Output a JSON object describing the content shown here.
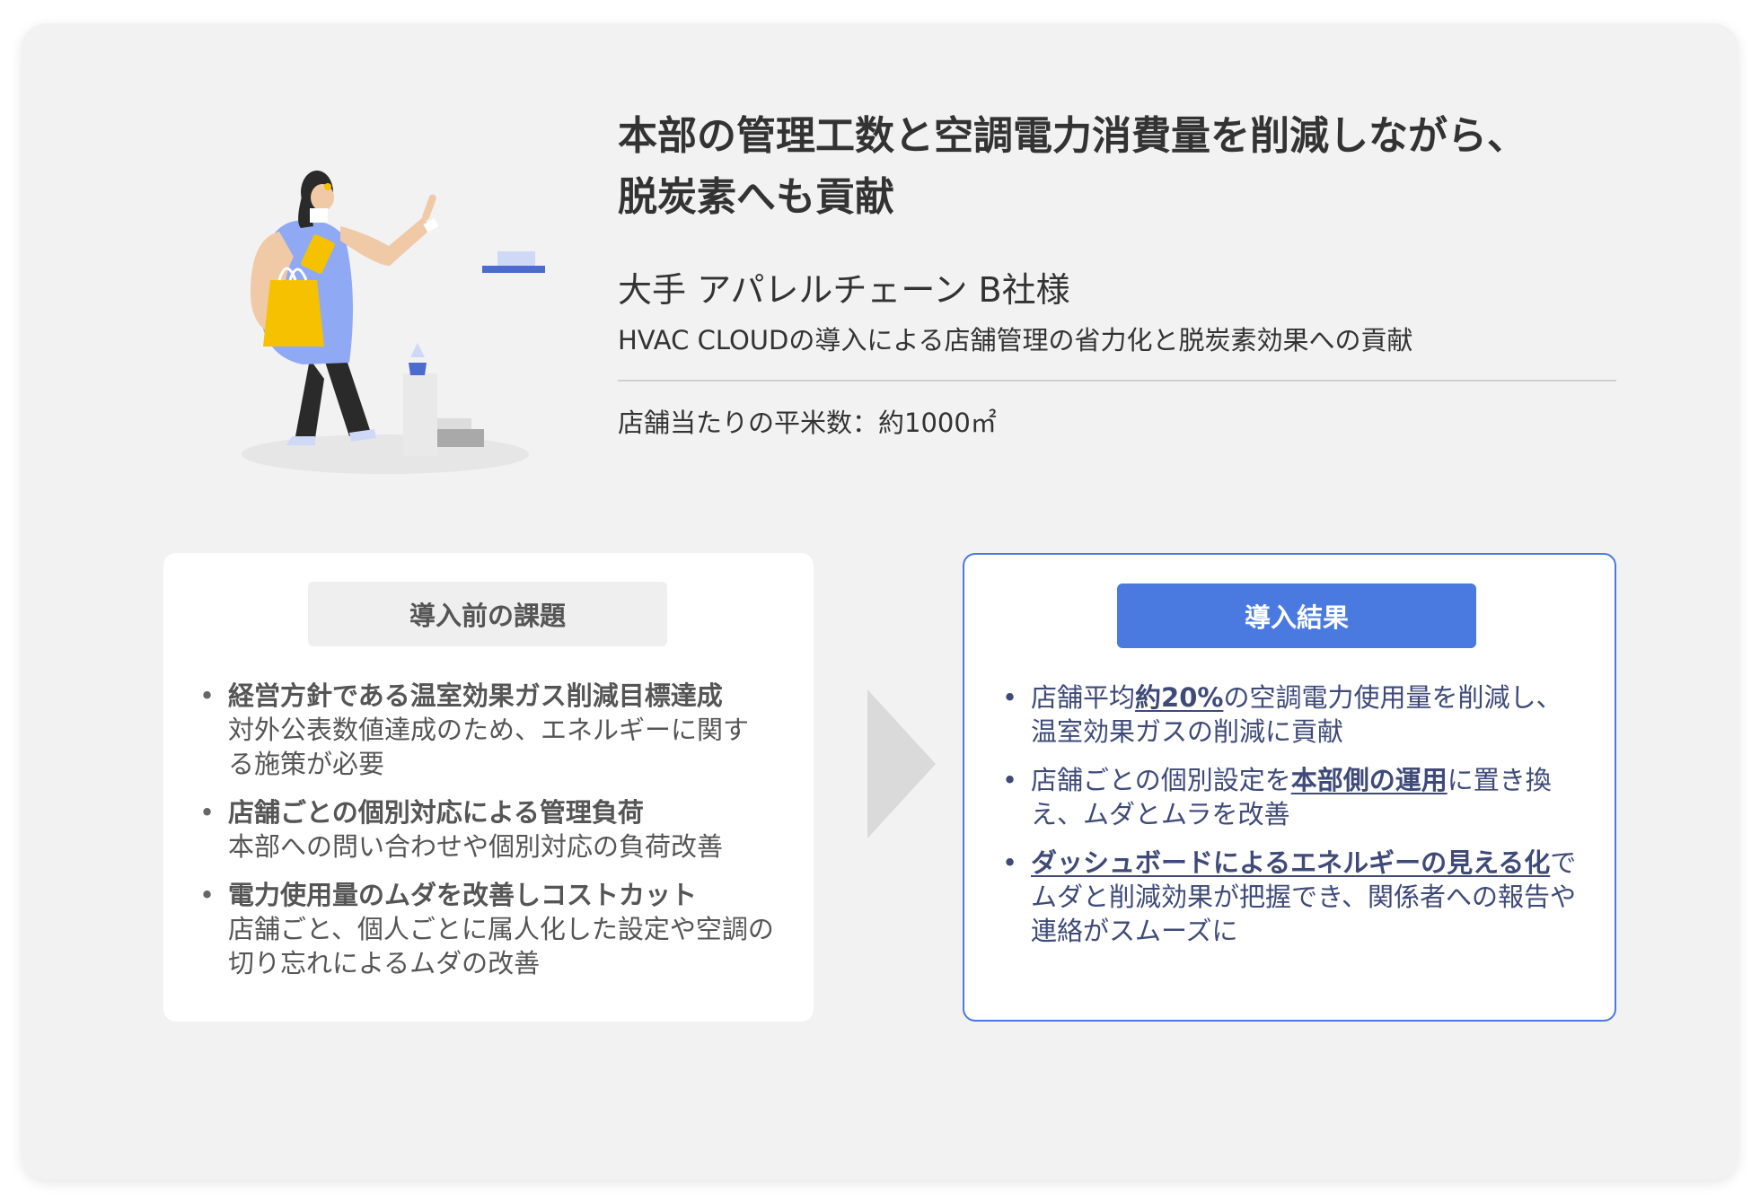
{
  "case": {
    "title_lines": [
      "本部の管理工数と空調電力消費量を削減しながら、",
      "脱炭素へも貢献"
    ],
    "client": "大手 アパレルチェーン B社様",
    "subtitle": "HVAC CLOUDの導入による店舗管理の省力化と脱炭素効果への貢献",
    "store_area": "店舗当たりの平米数：約1000㎡"
  },
  "before": {
    "heading": "導入前の課題",
    "items": [
      {
        "head": "経営方針である温室効果ガス削減目標達成",
        "body": "対外公表数値達成のため、エネルギーに関する施策が必要"
      },
      {
        "head": "店舗ごとの個別対応による管理負荷",
        "body": "本部への問い合わせや個別対応の負荷改善"
      },
      {
        "head": "電力使用量のムダを改善しコストカット",
        "body": "店舗ごと、個人ごとに属人化した設定や空調の切り忘れによるムダの改善"
      }
    ]
  },
  "after": {
    "heading": "導入結果",
    "items": [
      {
        "pre": "店舗平均",
        "hl": "約20%",
        "post": "の空調電力使用量を削減し、温室効果ガスの削減に貢献"
      },
      {
        "pre": "店舗ごとの個別設定を",
        "hl": "本部側の運用",
        "post": "に置き換え、ムダとムラを改善"
      },
      {
        "pre": "",
        "hl": "ダッシュボードによるエネルギーの見える化",
        "post": "でムダと削減効果が把握でき、関係者への報告や連絡がスムーズに"
      }
    ]
  },
  "colors": {
    "accent": "#4a7ae0",
    "highlight_text": "#3f4a78",
    "card_bg": "#f2f2f2"
  },
  "icons": {
    "illustration": "shopping-woman-illustration",
    "arrow": "chevron-right-icon"
  }
}
